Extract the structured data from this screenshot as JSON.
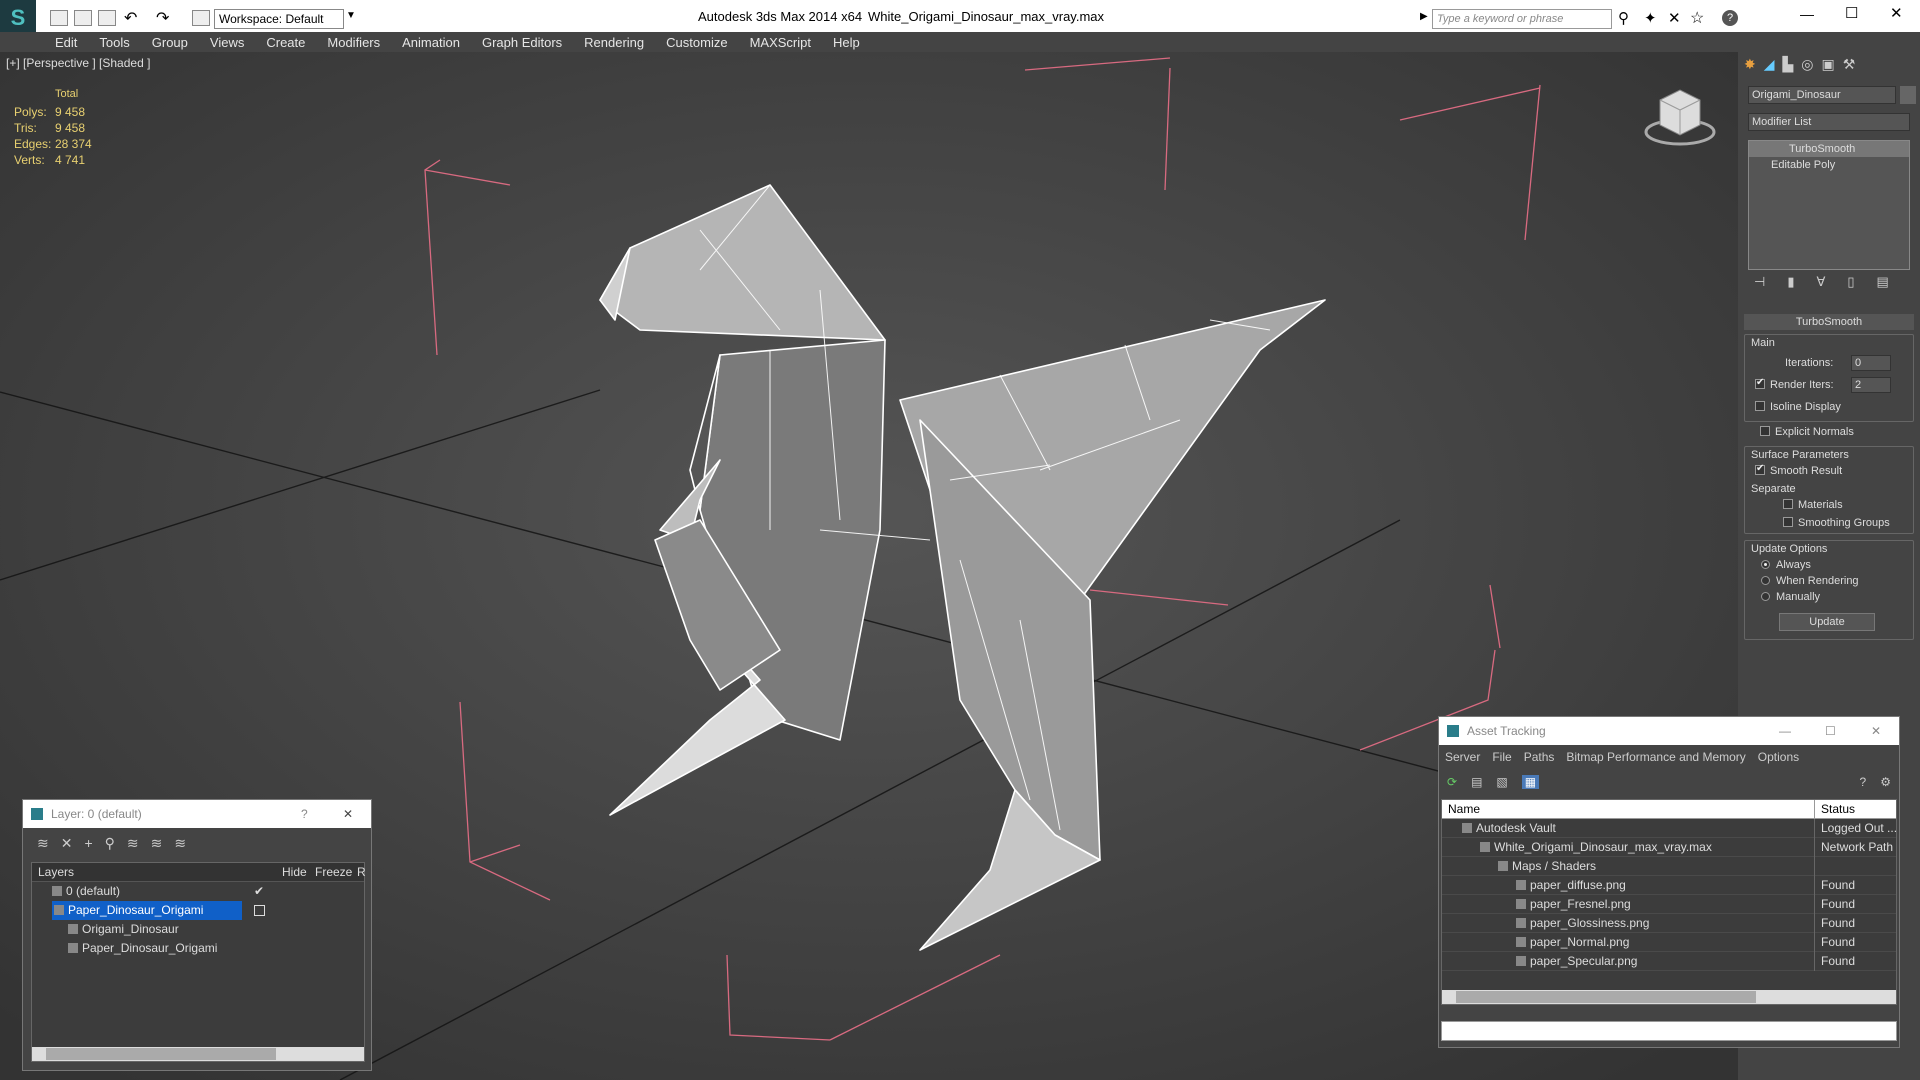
{
  "titlebar": {
    "app": "Autodesk 3ds Max  2014 x64",
    "file": "White_Origami_Dinosaur_max_vray.max",
    "workspace": "Workspace: Default",
    "search_placeholder": "Type a keyword or phrase"
  },
  "menu": [
    "Edit",
    "Tools",
    "Group",
    "Views",
    "Create",
    "Modifiers",
    "Animation",
    "Graph Editors",
    "Rendering",
    "Customize",
    "MAXScript",
    "Help"
  ],
  "viewport": {
    "label": "[+] [Perspective ] [Shaded ]",
    "stats_header": "Total",
    "stats": [
      {
        "k": "Polys:",
        "v": "9 458"
      },
      {
        "k": "Tris:",
        "v": "9 458"
      },
      {
        "k": "Edges:",
        "v": "28 374"
      },
      {
        "k": "Verts:",
        "v": "4 741"
      }
    ]
  },
  "cmd": {
    "object_name": "Origami_Dinosaur",
    "modifier_list": "Modifier List",
    "stack": [
      "TurboSmooth",
      "Editable Poly"
    ],
    "rollout_title": "TurboSmooth",
    "main": "Main",
    "iterations_label": "Iterations:",
    "iterations": "0",
    "render_iters_label": "Render Iters:",
    "render_iters": "2",
    "isoline": "Isoline Display",
    "explicit": "Explicit Normals",
    "surface": "Surface Parameters",
    "smooth_result": "Smooth Result",
    "separate": "Separate",
    "materials": "Materials",
    "smoothing_groups": "Smoothing Groups",
    "update_options": "Update Options",
    "always": "Always",
    "when_rendering": "When Rendering",
    "manually": "Manually",
    "update_btn": "Update"
  },
  "layers": {
    "title": "Layer: 0 (default)",
    "help": "?",
    "cols": {
      "layers": "Layers",
      "hide": "Hide",
      "freeze": "Freeze",
      "r": "R"
    },
    "rows": [
      "0 (default)",
      "Paper_Dinosaur_Origami",
      "Origami_Dinosaur",
      "Paper_Dinosaur_Origami"
    ]
  },
  "assets": {
    "title": "Asset Tracking",
    "menu": [
      "Server",
      "File",
      "Paths",
      "Bitmap Performance and Memory",
      "Options"
    ],
    "col_name": "Name",
    "col_status": "Status",
    "rows": [
      {
        "name": "Autodesk Vault",
        "status": "Logged Out ..."
      },
      {
        "name": "White_Origami_Dinosaur_max_vray.max",
        "status": "Network Path"
      },
      {
        "name": "Maps / Shaders",
        "status": ""
      },
      {
        "name": "paper_diffuse.png",
        "status": "Found"
      },
      {
        "name": "paper_Fresnel.png",
        "status": "Found"
      },
      {
        "name": "paper_Glossiness.png",
        "status": "Found"
      },
      {
        "name": "paper_Normal.png",
        "status": "Found"
      },
      {
        "name": "paper_Specular.png",
        "status": "Found"
      }
    ]
  }
}
